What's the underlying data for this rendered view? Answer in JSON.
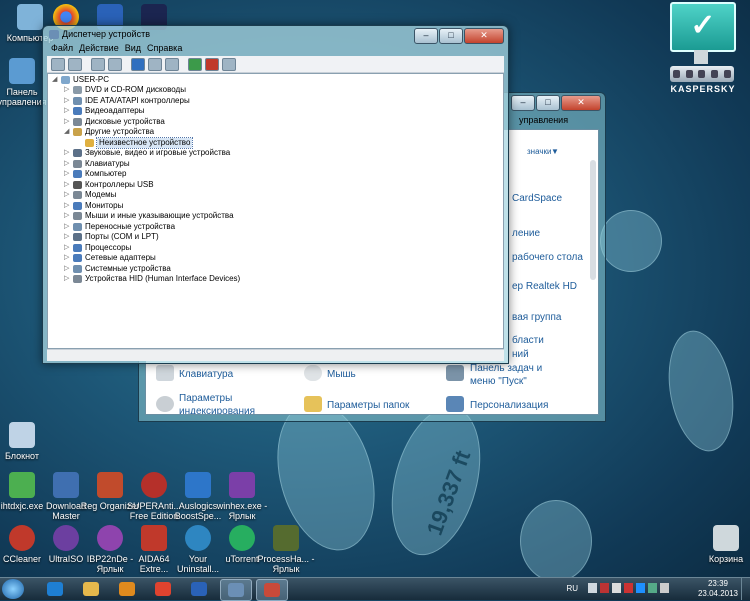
{
  "desktop": {
    "icons": [
      {
        "id": "computer",
        "label": "Компьютер",
        "icon": "computer-icon",
        "color": "#7fb3d9"
      },
      {
        "id": "chrome",
        "label": "",
        "icon": "chrome-icon",
        "color": "#e0432f"
      },
      {
        "id": "app-blue",
        "label": "",
        "icon": "app-icon",
        "color": "#2a62b8"
      },
      {
        "id": "moon",
        "label": "",
        "icon": "moon-icon",
        "color": "#1b2550"
      },
      {
        "id": "control-panel",
        "label": "Панель управления",
        "icon": "control-panel-icon",
        "color": "#5b9bd2"
      },
      {
        "id": "notepad",
        "label": "Блокнот",
        "icon": "notepad-icon",
        "color": "#bfd3e6"
      },
      {
        "id": "ihtdxjc",
        "label": "ihtdxjc.exe",
        "icon": "exe-icon",
        "color": "#4caf50"
      },
      {
        "id": "download-master",
        "label": "Download Master",
        "icon": "download-master-icon",
        "color": "#3f6fb0"
      },
      {
        "id": "reg-organizer",
        "label": "Reg Organizer",
        "icon": "reg-organizer-icon",
        "color": "#c14b2c"
      },
      {
        "id": "superantispyware",
        "label": "SUPERAnti... Free Edition",
        "icon": "superantispyware-icon",
        "color": "#b5302a"
      },
      {
        "id": "auslogics",
        "label": "Auslogics BoostSpe...",
        "icon": "auslogics-icon",
        "color": "#2d76c9"
      },
      {
        "id": "winhex",
        "label": "winhex.exe - Ярлык",
        "icon": "winhex-icon",
        "color": "#7b3fa8"
      },
      {
        "id": "ccleaner",
        "label": "CCleaner",
        "icon": "ccleaner-icon",
        "color": "#c0392b"
      },
      {
        "id": "ultraiso",
        "label": "UltraISO",
        "icon": "ultraiso-icon",
        "color": "#6c3fa0"
      },
      {
        "id": "ib22",
        "label": "IBP22nDe - Ярлык",
        "icon": "ib-icon",
        "color": "#8e44ad"
      },
      {
        "id": "aida64",
        "label": "AIDA64 Extre...",
        "icon": "aida64-icon",
        "color": "#c0392b"
      },
      {
        "id": "your-uninstaller",
        "label": "Your Uninstall...",
        "icon": "uninstaller-icon",
        "color": "#2e86c1"
      },
      {
        "id": "utorrent",
        "label": "uTorrent",
        "icon": "utorrent-icon",
        "color": "#27ae60"
      },
      {
        "id": "processhacker",
        "label": "ProcessHa... - Ярлык",
        "icon": "processhacker-icon",
        "color": "#556b2f"
      },
      {
        "id": "recycle-bin",
        "label": "Корзина",
        "icon": "recycle-bin-icon",
        "color": "#cfd8dc"
      }
    ],
    "footprint_text": "19,337 ft"
  },
  "kaspersky": {
    "brand": "KASPERSKY",
    "check_glyph": "✓"
  },
  "control_panel": {
    "favorites_label": "значки",
    "title_fragment": "управления",
    "items_right": [
      "CardSpace",
      "ление",
      "рабочего стола",
      "ер Realtek HD",
      "вая группа",
      "бласти",
      "ний"
    ],
    "items_bottom": [
      {
        "label": "Клавиатура",
        "icon": "keyboard-icon"
      },
      {
        "label": "Мышь",
        "icon": "mouse-icon"
      },
      {
        "label": "Панель задач и меню \"Пуск\"",
        "icon": "taskbar-icon"
      },
      {
        "label": "Параметры индексирования",
        "icon": "indexing-icon"
      },
      {
        "label": "Параметры папок",
        "icon": "folder-options-icon"
      },
      {
        "label": "Персонализация",
        "icon": "personalization-icon"
      }
    ]
  },
  "device_manager": {
    "title": "Диспетчер устройств",
    "menu": [
      "Файл",
      "Действие",
      "Вид",
      "Справка"
    ],
    "root": "USER-PC",
    "nodes": [
      {
        "label": "DVD и CD-ROM дисководы",
        "color": "#8a9aa8"
      },
      {
        "label": "IDE ATA/ATAPI контроллеры",
        "color": "#6f8faf"
      },
      {
        "label": "Видеоадаптеры",
        "color": "#4a7bbb"
      },
      {
        "label": "Дисковые устройства",
        "color": "#7b8895"
      },
      {
        "label": "Другие устройства",
        "color": "#c9a24a",
        "expanded": true
      },
      {
        "label": "Неизвестное устройство",
        "color": "#e0b040",
        "child": true,
        "selected": true
      },
      {
        "label": "Звуковые, видео и игровые устройства",
        "color": "#5c7088"
      },
      {
        "label": "Клавиатуры",
        "color": "#7b8895"
      },
      {
        "label": "Компьютер",
        "color": "#4a7bbb"
      },
      {
        "label": "Контроллеры USB",
        "color": "#555"
      },
      {
        "label": "Модемы",
        "color": "#7b8895"
      },
      {
        "label": "Мониторы",
        "color": "#4a7bbb"
      },
      {
        "label": "Мыши и иные указывающие устройства",
        "color": "#7b8895"
      },
      {
        "label": "Переносные устройства",
        "color": "#6f8faf"
      },
      {
        "label": "Порты (COM и LPT)",
        "color": "#5c7088"
      },
      {
        "label": "Процессоры",
        "color": "#4a7bbb"
      },
      {
        "label": "Сетевые адаптеры",
        "color": "#4a7bbb"
      },
      {
        "label": "Системные устройства",
        "color": "#6f8faf"
      },
      {
        "label": "Устройства HID (Human Interface Devices)",
        "color": "#7b8895"
      }
    ]
  },
  "taskbar": {
    "apps": [
      {
        "name": "ie",
        "icon": "internet-explorer-icon",
        "color": "#1e7fd3"
      },
      {
        "name": "explorer",
        "icon": "folder-icon",
        "color": "#e6b84c"
      },
      {
        "name": "media",
        "icon": "media-player-icon",
        "color": "#e08a1e"
      },
      {
        "name": "chrome",
        "icon": "chrome-icon",
        "color": "#e0432f"
      },
      {
        "name": "app",
        "icon": "app-icon",
        "color": "#2a62b8"
      },
      {
        "name": "device-manager",
        "icon": "device-manager-icon",
        "color": "#6b8fb5"
      },
      {
        "name": "control-panel",
        "icon": "control-panel-icon",
        "color": "#c94a3a"
      }
    ],
    "lang": "RU",
    "time": "23:39",
    "date": "23.04.2013"
  }
}
